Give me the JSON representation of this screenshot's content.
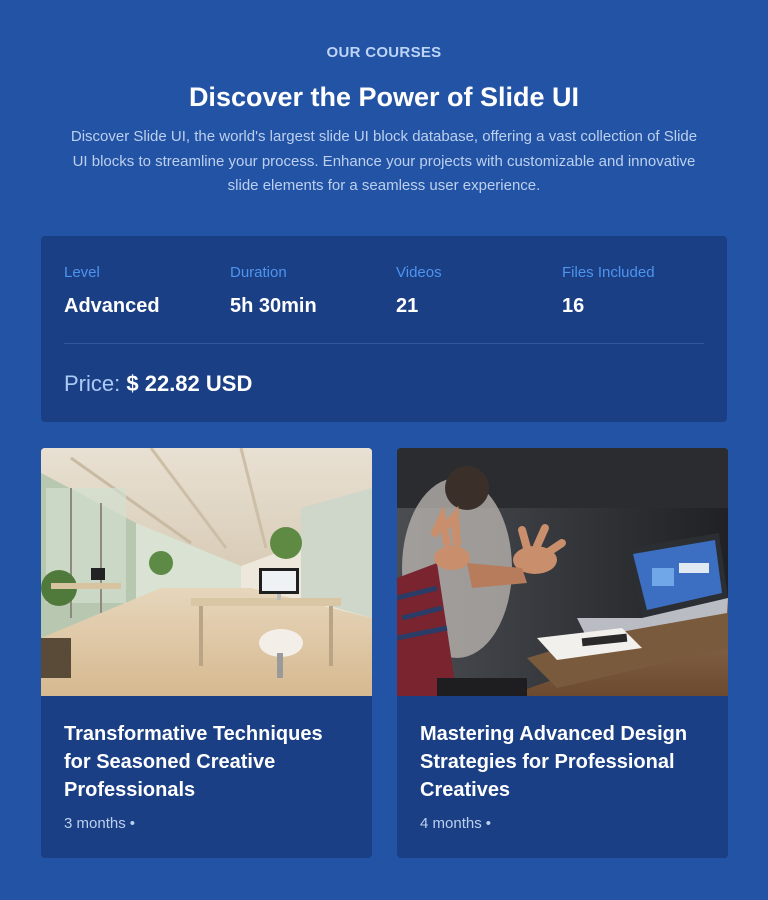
{
  "header": {
    "eyebrow": "OUR COURSES",
    "title": "Discover the Power of Slide UI",
    "description": "Discover Slide UI, the world's largest slide UI block database, offering a vast collection of Slide UI blocks to streamline your process. Enhance your projects with customizable and innovative slide elements for a seamless user experience."
  },
  "details": {
    "stats": [
      {
        "label": "Level",
        "value": "Advanced"
      },
      {
        "label": "Duration",
        "value": "5h 30min"
      },
      {
        "label": "Videos",
        "value": "21"
      },
      {
        "label": "Files Included",
        "value": "16"
      }
    ],
    "price_label": "Price:",
    "price_value": "$ 22.82 USD"
  },
  "courses": [
    {
      "title": "Transformative Techniques for Seasoned Creative Professionals",
      "duration": "3 months",
      "separator": "•",
      "image": "office-interior-photo"
    },
    {
      "title": "Mastering Advanced Design Strategies for Professional Creatives",
      "duration": "4 months",
      "separator": "•",
      "image": "laptop-meeting-photo"
    }
  ],
  "colors": {
    "background": "#2353a5",
    "card": "#1b3f85",
    "accent": "#4d94ee"
  }
}
